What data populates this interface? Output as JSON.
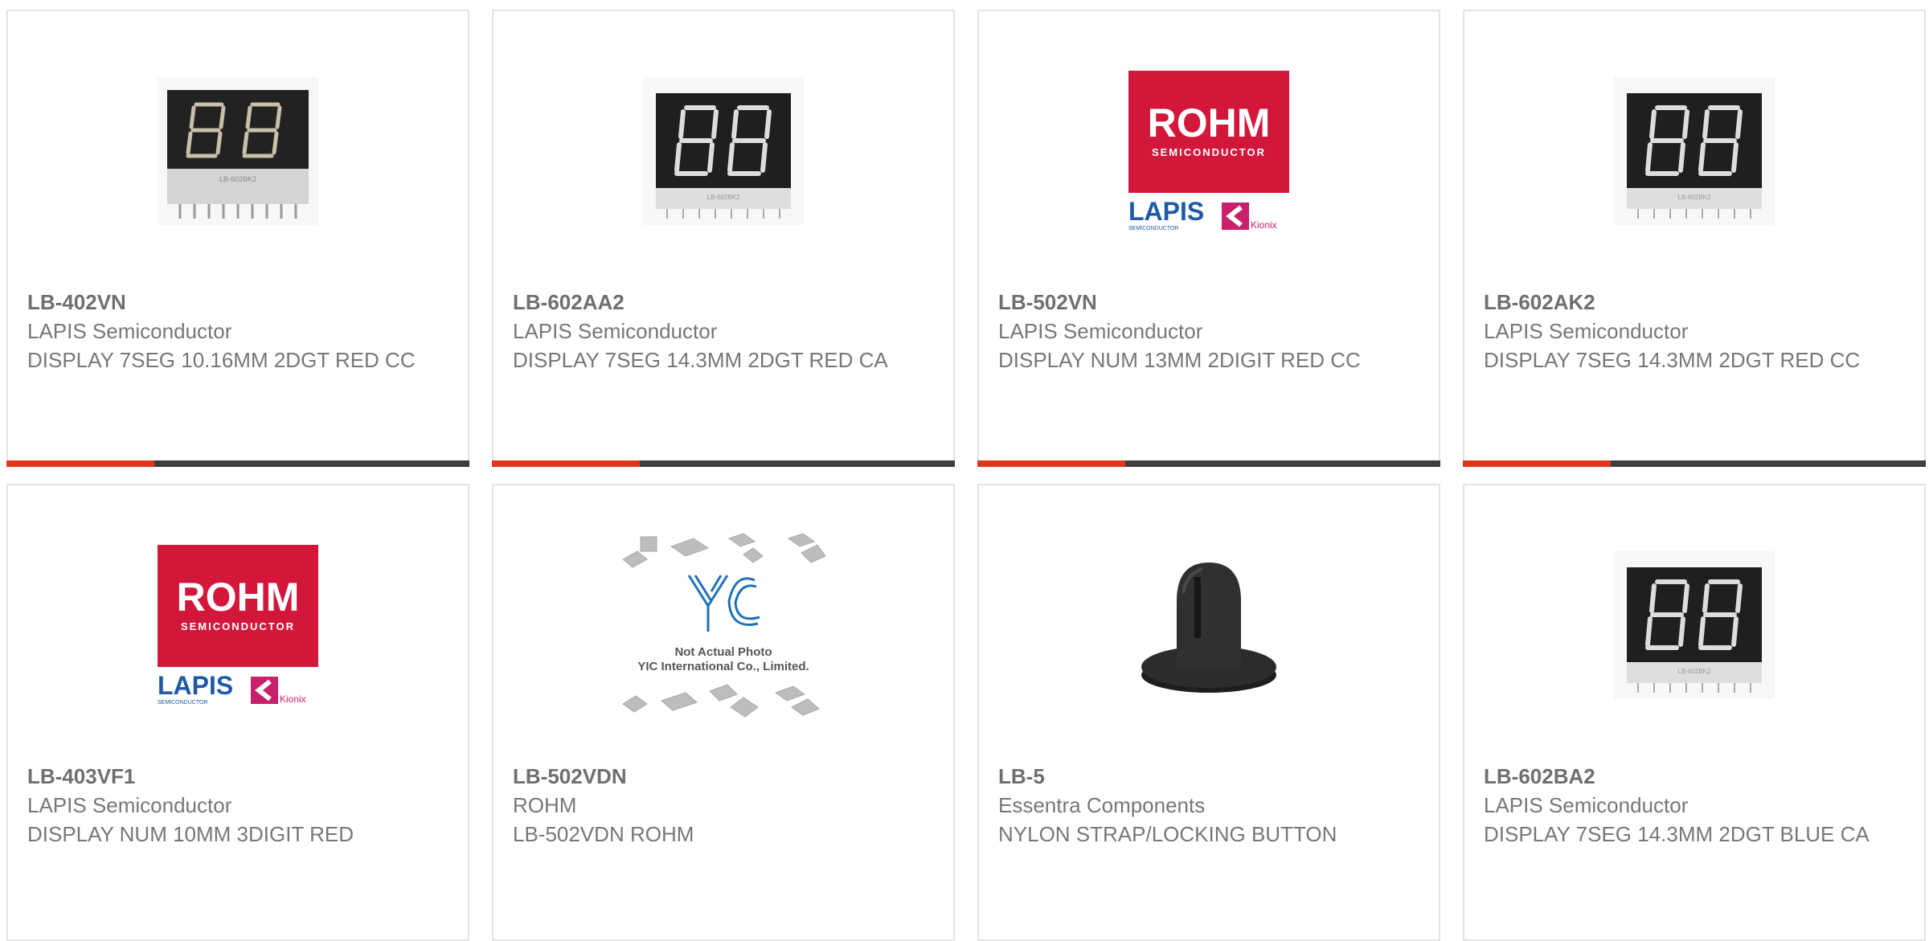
{
  "colors": {
    "accent": "#e0371c",
    "bar": "#3d3d3d",
    "border": "#e4e4e4",
    "rohm_red": "#d3173b",
    "lapis_blue": "#1f5aa6",
    "kionix_pink": "#c8206a"
  },
  "products": [
    {
      "part": "LB-402VN",
      "maker": "LAPIS Semiconductor",
      "desc": "DISPLAY 7SEG 10.16MM 2DGT RED CC",
      "image": "seven-segment-display-2digit"
    },
    {
      "part": "LB-602AA2",
      "maker": "LAPIS Semiconductor",
      "desc": "DISPLAY 7SEG 14.3MM 2DGT RED CA",
      "image": "seven-segment-display-2digit"
    },
    {
      "part": "LB-502VN",
      "maker": "LAPIS Semiconductor",
      "desc": "DISPLAY NUM 13MM 2DIGIT RED CC",
      "image": "rohm-logo"
    },
    {
      "part": "LB-602AK2",
      "maker": "LAPIS Semiconductor",
      "desc": "DISPLAY 7SEG 14.3MM 2DGT RED CC",
      "image": "seven-segment-display-2digit"
    },
    {
      "part": "LB-403VF1",
      "maker": "LAPIS Semiconductor",
      "desc": "DISPLAY NUM 10MM 3DIGIT RED",
      "image": "rohm-logo"
    },
    {
      "part": "LB-502VDN",
      "maker": "ROHM",
      "desc": "LB-502VDN ROHM",
      "image": "not-actual-photo"
    },
    {
      "part": "LB-5",
      "maker": "Essentra Components",
      "desc": "NYLON STRAP/LOCKING BUTTON",
      "image": "locking-button"
    },
    {
      "part": "LB-602BA2",
      "maker": "LAPIS Semiconductor",
      "desc": "DISPLAY 7SEG 14.3MM 2DGT BLUE CA",
      "image": "seven-segment-display-2digit"
    }
  ],
  "logos": {
    "rohm": "ROHM",
    "rohm_sub": "SEMICONDUCTOR",
    "lapis": "LAPIS",
    "lapis_sub": "SEMICONDUCTOR",
    "kionix": "Kionix",
    "display_label": "LB-602BK2"
  },
  "placeholder": {
    "brand": "YIC",
    "line1": "Not Actual Photo",
    "line2": "YIC International Co., Limited."
  }
}
